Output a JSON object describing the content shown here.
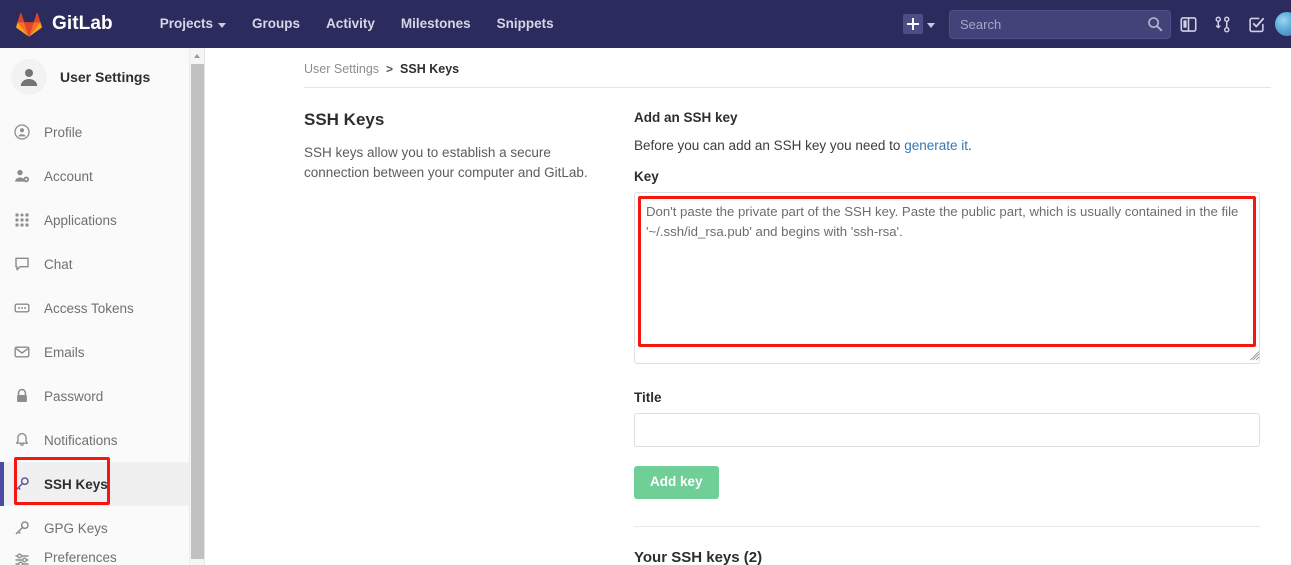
{
  "navbar": {
    "brand": "GitLab",
    "brand_logo_icon": "gitlab-tanuki-logo",
    "links": [
      {
        "label": "Projects",
        "has_caret": true
      },
      {
        "label": "Groups",
        "has_caret": false
      },
      {
        "label": "Activity",
        "has_caret": false
      },
      {
        "label": "Milestones",
        "has_caret": false
      },
      {
        "label": "Snippets",
        "has_caret": false
      }
    ],
    "new_button": {
      "icon": "plus-icon",
      "caret_icon": "chevron-down-icon",
      "label": ""
    },
    "search": {
      "placeholder": "Search",
      "value": "",
      "icon": "search-icon"
    },
    "icons": [
      {
        "name": "issue-boards-icon"
      },
      {
        "name": "merge-requests-icon"
      },
      {
        "name": "todos-icon"
      }
    ],
    "avatar_icon": "user-avatar"
  },
  "sidebar": {
    "header": {
      "title": "User Settings",
      "avatar_icon": "user-avatar-icon"
    },
    "items": [
      {
        "label": "Profile",
        "icon": "profile-icon",
        "active": false
      },
      {
        "label": "Account",
        "icon": "account-icon",
        "active": false
      },
      {
        "label": "Applications",
        "icon": "applications-icon",
        "active": false
      },
      {
        "label": "Chat",
        "icon": "chat-icon",
        "active": false
      },
      {
        "label": "Access Tokens",
        "icon": "access-tokens-icon",
        "active": false
      },
      {
        "label": "Emails",
        "icon": "email-icon",
        "active": false
      },
      {
        "label": "Password",
        "icon": "lock-icon",
        "active": false
      },
      {
        "label": "Notifications",
        "icon": "bell-icon",
        "active": false
      },
      {
        "label": "SSH Keys",
        "icon": "key-icon",
        "active": true
      },
      {
        "label": "GPG Keys",
        "icon": "key-icon",
        "active": false
      },
      {
        "label": "Preferences",
        "icon": "preferences-icon",
        "active": false
      }
    ],
    "scrollbar": {
      "up_arrow_icon": "scroll-up-arrow"
    }
  },
  "breadcrumb": {
    "parent": "User Settings",
    "separator": ">",
    "current": "SSH Keys"
  },
  "main": {
    "left": {
      "title": "SSH Keys",
      "description": "SSH keys allow you to establish a secure connection between your computer and GitLab."
    },
    "right": {
      "heading": "Add an SSH key",
      "subtext_before": "Before you can add an SSH key you need to ",
      "subtext_link": "generate it",
      "subtext_after": ".",
      "key_label": "Key",
      "key_placeholder": "Don't paste the private part of the SSH key. Paste the public part, which is usually contained in the file '~/.ssh/id_rsa.pub' and begins with 'ssh-rsa'.",
      "key_value": "",
      "title_label": "Title",
      "title_placeholder": "",
      "title_value": "",
      "submit_label": "Add key",
      "keys_list_heading": "Your SSH keys (2)"
    }
  },
  "annotations": [
    {
      "name": "ssh-keys-sidebar-highlight",
      "color": "#f5170f"
    },
    {
      "name": "key-textarea-highlight",
      "color": "#f5170f"
    }
  ],
  "colors": {
    "navbar_bg": "#2b2b5e",
    "accent_purple": "#4b4ba3",
    "link_blue": "#3777b0",
    "button_green": "#6fcf97",
    "annotation_red": "#f5170f",
    "sidebar_bg": "#fafafa"
  }
}
